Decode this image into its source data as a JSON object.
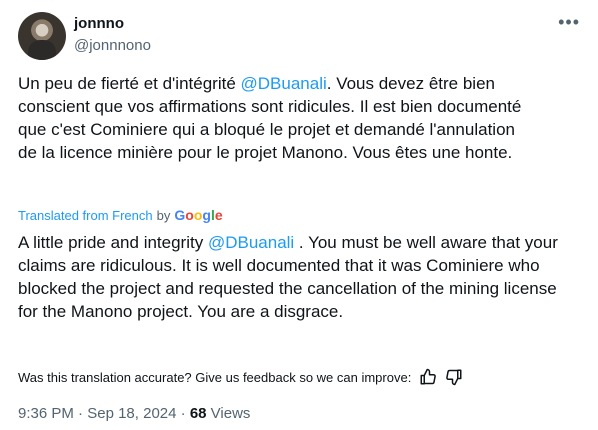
{
  "header": {
    "name": "jonnno",
    "handle": "@jonnnono",
    "more_label": "•••"
  },
  "tweet": {
    "original_pre": "Un peu de fierté et d'intégrité ",
    "original_mention": "@DBuanali",
    "original_post": ". Vous devez être bien conscient que vos affirmations sont ridicules. Il est bien documenté que c'est Cominiere qui a bloqué le projet et demandé l'annulation de la licence minière pour le projet Manono. Vous êtes une honte.",
    "translated_label": "Translated from French",
    "by_label": "by",
    "google_letters": [
      "G",
      "o",
      "o",
      "g",
      "l",
      "e"
    ],
    "translation_pre": "A little pride and integrity ",
    "translation_mention": "@DBuanali",
    "translation_post": " . You must be well aware that your claims are ridiculous. It is well documented that it was Cominiere who blocked the project and requested the cancellation of the mining license for the Manono project. You are a disgrace."
  },
  "feedback": {
    "text": "Was this translation accurate? Give us feedback so we can improve:",
    "thumbs_up_icon": "thumbs-up-icon",
    "thumbs_down_icon": "thumbs-down-icon"
  },
  "meta": {
    "time": "9:36 PM",
    "sep1": " · ",
    "date": "Sep 18, 2024",
    "sep2": " · ",
    "views_count": "68",
    "views_label": " Views"
  },
  "colors": {
    "link": "#1d9bf0",
    "secondary": "#536471",
    "google": [
      "#4285F4",
      "#EA4335",
      "#FBBC05",
      "#4285F4",
      "#34A853",
      "#EA4335"
    ]
  }
}
